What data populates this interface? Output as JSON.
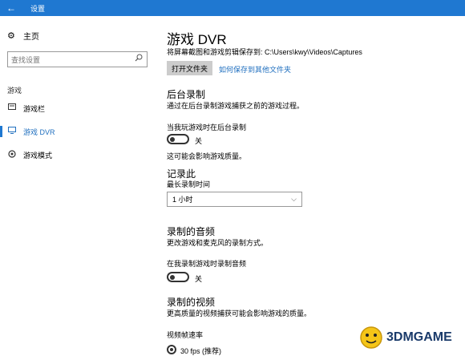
{
  "titlebar": {
    "back_glyph": "←",
    "title": "设置"
  },
  "sidebar": {
    "home_icon": "gear-icon",
    "home_label": "主页",
    "search_placeholder": "查找设置",
    "section_label": "游戏",
    "items": [
      {
        "label": "游戏栏",
        "icon": "game-bar-icon",
        "selected": false
      },
      {
        "label": "游戏 DVR",
        "icon": "dvr-icon",
        "selected": true
      },
      {
        "label": "游戏模式",
        "icon": "game-mode-icon",
        "selected": false
      }
    ]
  },
  "main": {
    "title": "游戏 DVR",
    "save_path_text": "将屏幕截图和游戏剪辑保存到: C:\\Users\\kwy\\Videos\\Captures",
    "open_folder_button": "打开文件夹",
    "save_elsewhere_link": "如何保存到其他文件夹",
    "background": {
      "heading": "后台录制",
      "description": "通过在后台录制游戏捕获之前的游戏过程。",
      "toggle_label": "当我玩游戏时在后台录制",
      "toggle_state": "关",
      "note": "这可能会影响游戏质量。"
    },
    "record_this": {
      "heading": "记录此",
      "max_label": "最长录制时间",
      "dropdown_value": "1 小时"
    },
    "audio": {
      "heading": "录制的音频",
      "description": "更改游戏和麦克风的录制方式。",
      "toggle_label": "在我录制游戏时录制音频",
      "toggle_state": "关"
    },
    "video": {
      "heading": "录制的视频",
      "description": "更高质量的视频捕获可能会影响游戏的质量。",
      "framerate_label": "视频帧速率",
      "option_30": "30 fps (推荐)"
    }
  },
  "watermark": {
    "text": "3DMGAME"
  },
  "colors": {
    "accent": "#1f78d1",
    "link": "#1f6fbf"
  }
}
